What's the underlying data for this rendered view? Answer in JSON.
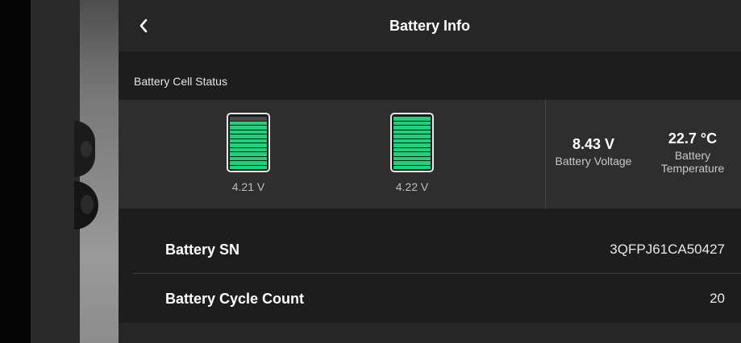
{
  "header": {
    "title": "Battery Info",
    "back_icon": "chevron-left-icon"
  },
  "cell_status": {
    "section_title": "Battery Cell Status",
    "cells": [
      {
        "voltage": "4.21 V",
        "level_fraction": 0.92
      },
      {
        "voltage": "4.22 V",
        "level_fraction": 1.0
      }
    ],
    "voltage": {
      "value": "8.43 V",
      "label": "Battery Voltage"
    },
    "temperature": {
      "value": "22.7 °C",
      "label_line1": "Battery",
      "label_line2": "Temperature"
    },
    "accent_color": "#22d07a"
  },
  "info": {
    "serial": {
      "label": "Battery SN",
      "value": "3QFPJ61CA50427"
    },
    "cycle_count": {
      "label": "Battery Cycle Count",
      "value": "20"
    }
  }
}
